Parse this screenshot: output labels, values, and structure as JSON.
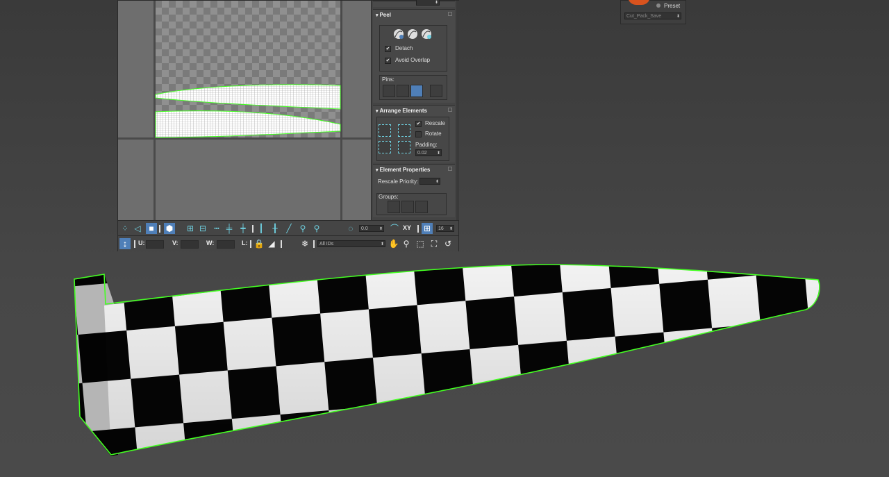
{
  "peel": {
    "title": "Peel",
    "detach_label": "Detach",
    "detach_checked": true,
    "avoid_overlap_label": "Avoid Overlap",
    "avoid_overlap_checked": true,
    "pins_label": "Pins:"
  },
  "arrange": {
    "title": "Arrange Elements",
    "rescale_label": "Rescale",
    "rescale_checked": true,
    "rotate_label": "Rotate",
    "rotate_checked": false,
    "padding_label": "Padding:",
    "padding_value": "0.02"
  },
  "element_props": {
    "title": "Element Properties",
    "rescale_priority_label": "Rescale Priority:",
    "groups_label": "Groups:"
  },
  "toolbar1": {
    "angle_value": "0.0",
    "xy_label": "XY",
    "grid_value": "16"
  },
  "toolbar2": {
    "u_label": "U:",
    "v_label": "V:",
    "w_label": "W:",
    "l_label": "L:",
    "ids_value": "All IDs"
  },
  "preset": {
    "label": "Preset",
    "dropdown_value": "Cut_Pack_Save"
  },
  "colors": {
    "selection_green": "#44ff22",
    "accent_blue": "#4f7fb8",
    "tool_cyan": "#6fd0e0",
    "swatch_orange": "#d9531e"
  }
}
